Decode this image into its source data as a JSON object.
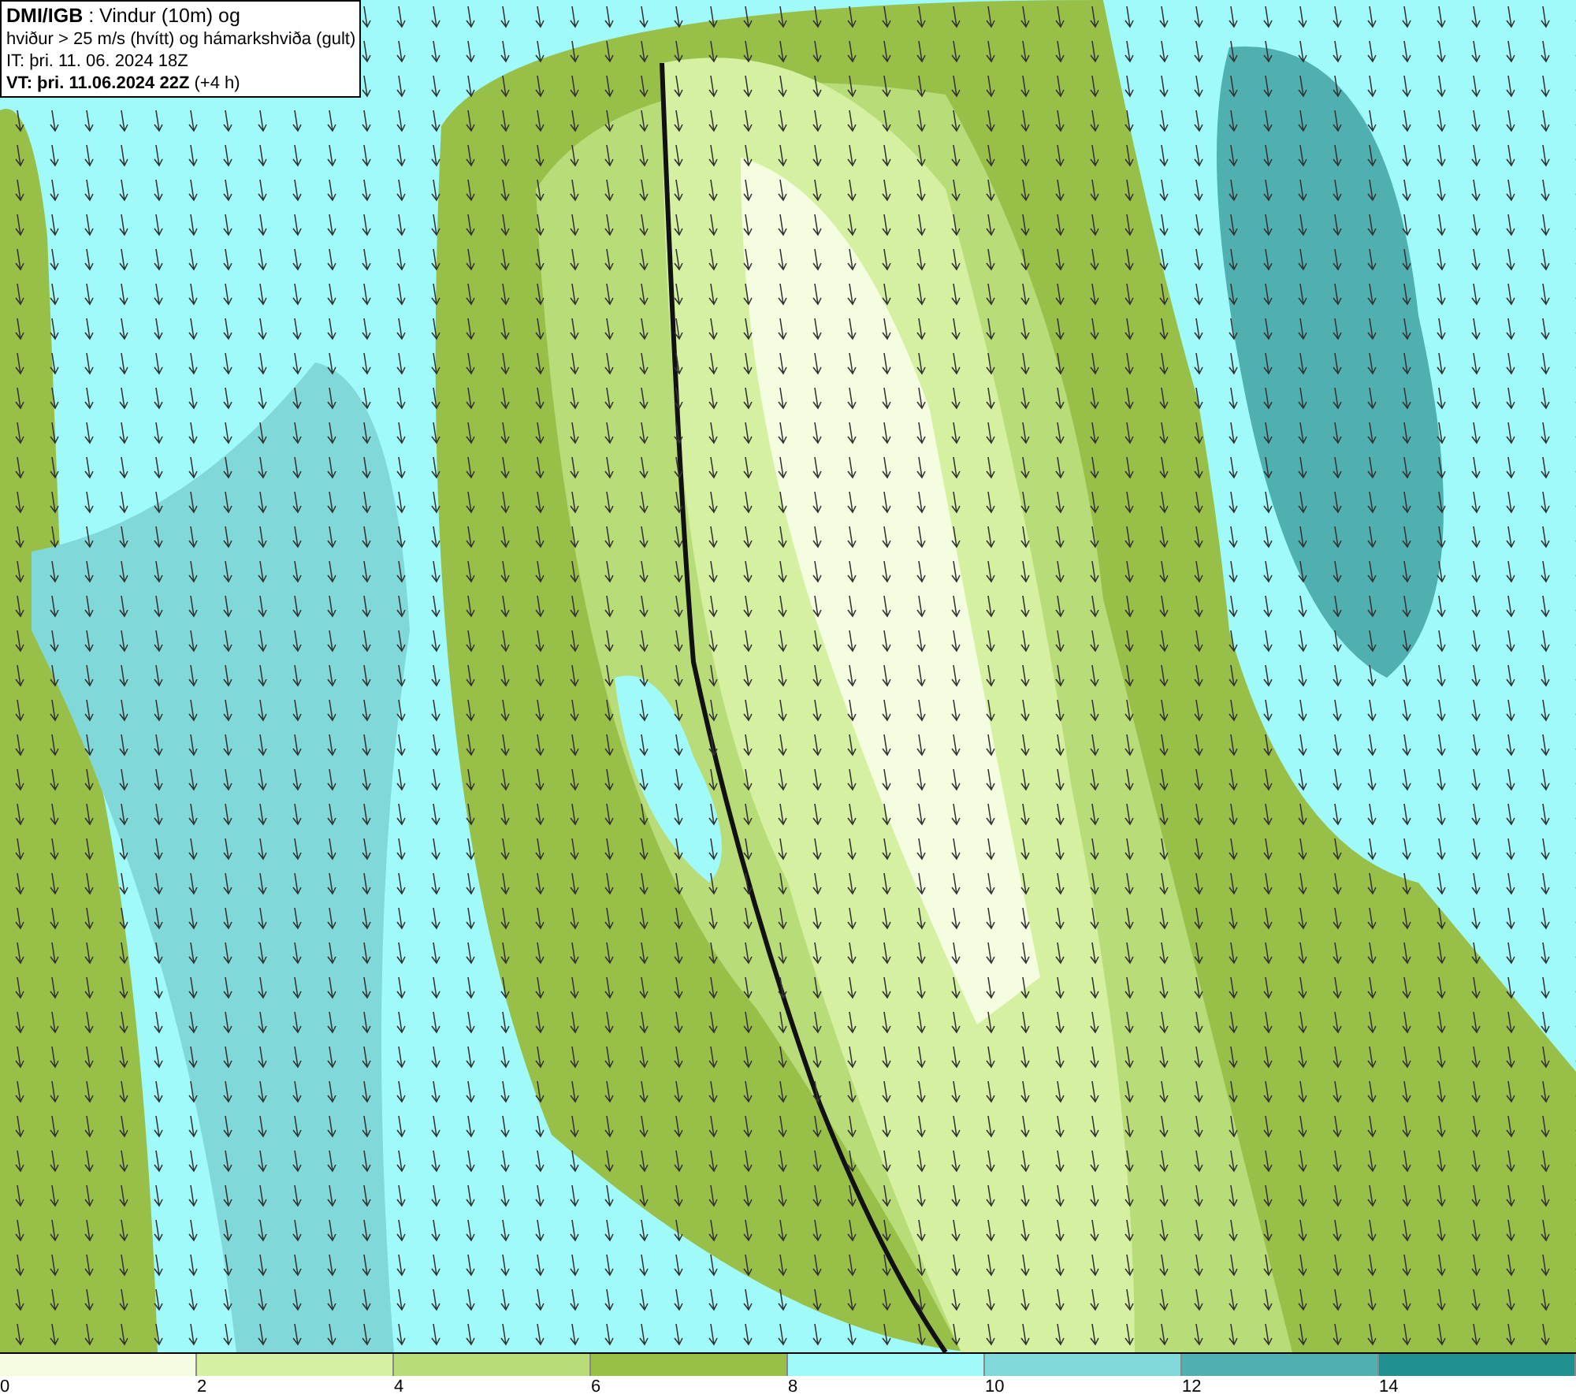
{
  "title_box": {
    "lines": [
      "**DMI/IGB** : Vindur (10m) og",
      "hviður > 25 m/s (hvítt) og hámarkshviða (gult)",
      "IT: þri. 11. 06. 2024 18Z",
      "**VT: þri. 11.06.2024 22Z** (+4 h)"
    ]
  },
  "legend": {
    "bins": [
      {
        "color": "#f5fde0",
        "label": "0"
      },
      {
        "color": "#d4f0a0",
        "label": "2"
      },
      {
        "color": "#b8dc78",
        "label": "4"
      },
      {
        "color": "#98c048",
        "label": "6"
      },
      {
        "color": "#a0fafa",
        "label": "8"
      },
      {
        "color": "#80d8d8",
        "label": "10"
      },
      {
        "color": "#50b0b0",
        "label": "12"
      },
      {
        "color": "#209090",
        "label": "14"
      }
    ]
  }
}
